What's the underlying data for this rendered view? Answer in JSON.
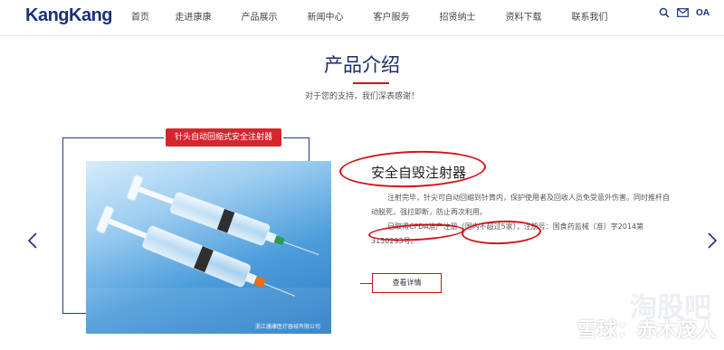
{
  "header": {
    "logo": "KangKang",
    "nav": [
      "首页",
      "走进康康",
      "产品展示",
      "新闻中心",
      "客户服务",
      "招贤纳士",
      "资料下载",
      "联系我们"
    ],
    "oa": "OA",
    "icons": [
      "search-icon",
      "mail-icon"
    ]
  },
  "section": {
    "title": "产品介绍",
    "subtitle": "对于您的支持，我们深表感谢！"
  },
  "product": {
    "tag": "针头自动回缩式安全注射器",
    "name": "安全自毁注射器",
    "desc_line1": "注射完毕，针尖可自动回缩到针筒内，保护使用者及回收人员免受意外伤害。同时推杆自",
    "desc_line2": "动脱死，强拉即断，防止再次利用。",
    "desc_line3": "已取得CFDA准产注册（国内不超过5家），注册号：国食药监械（准）字2014第",
    "desc_line4": "3150293号。",
    "more": "查看详情",
    "photo_caption": "浙江康康医疗器械有限公司"
  },
  "watermark": {
    "faint": "淘股吧",
    "text": "雪球：赤木茂人"
  },
  "colors": {
    "brand": "#1c2f7a",
    "accent": "#c8161e",
    "tag": "#d5252d"
  }
}
